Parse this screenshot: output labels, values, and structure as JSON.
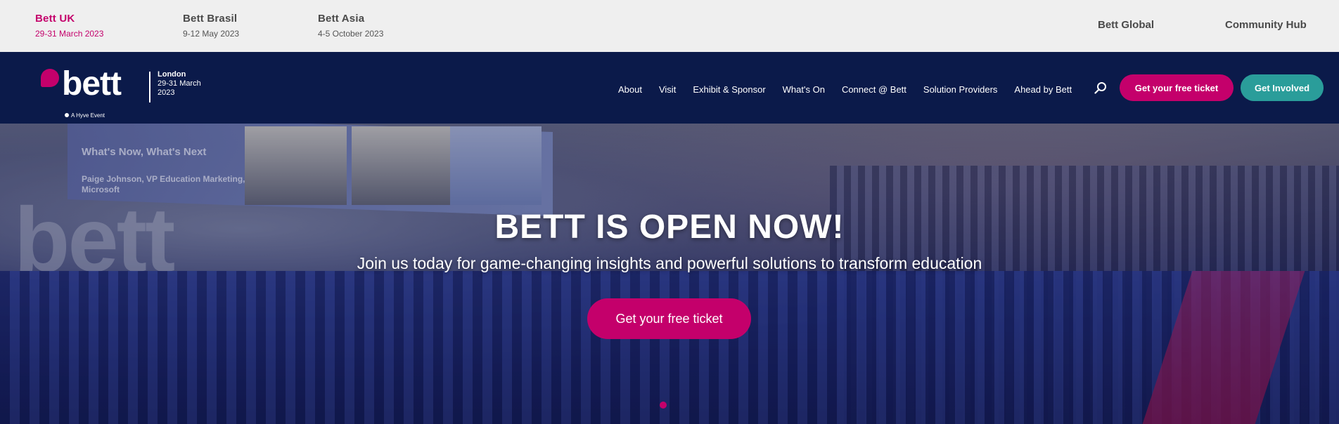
{
  "topbar": {
    "events": [
      {
        "name": "Bett UK",
        "date": "29-31 March 2023"
      },
      {
        "name": "Bett Brasil",
        "date": "9-12 May 2023"
      },
      {
        "name": "Bett Asia",
        "date": "4-5 October 2023"
      }
    ],
    "links": [
      "Bett Global",
      "Community Hub"
    ]
  },
  "logo": {
    "word": "bett",
    "tagline": "A Hyve Event",
    "city": "London",
    "dates_line1": "29-31 March",
    "dates_line2": "2023"
  },
  "nav": {
    "items": [
      "About",
      "Visit",
      "Exhibit & Sponsor",
      "What's On",
      "Connect @ Bett",
      "Solution Providers",
      "Ahead by Bett"
    ],
    "ticket_button": "Get your free ticket",
    "involved_button": "Get Involved"
  },
  "hero": {
    "screen_title": "What's Now, What's Next",
    "screen_speaker": "Paige Johnson, VP Education Marketing,",
    "screen_company": "Microsoft",
    "backdrop_logo": "bett",
    "headline": "BETT IS OPEN NOW!",
    "subheadline": "Join us today for game-changing insights and powerful solutions to transform education",
    "cta": "Get your free ticket"
  },
  "colors": {
    "brand_pink": "#c4006b",
    "navy": "#0b1a4a",
    "teal": "#2a9d9a",
    "topbar_bg": "#efefef"
  }
}
